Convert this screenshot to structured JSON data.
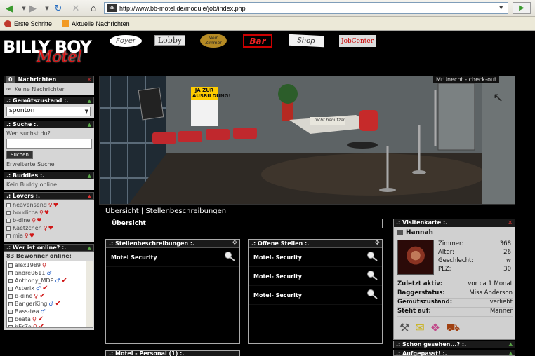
{
  "browser": {
    "url": "http://www.bb-motel.de/module/job/index.php",
    "bookmarks": [
      "Erste Schritte",
      "Aktuelle Nachrichten"
    ]
  },
  "logo": {
    "line1": "BILLY BOY",
    "line2": "Motel"
  },
  "nav": {
    "foyer": "Foyer",
    "lobby": "Lobby",
    "zimmer": "Mein Zimmer",
    "bar": "Bar",
    "shop": "Shop",
    "job": "JobCenter"
  },
  "scene": {
    "checkout": "MrUnecht - check-out",
    "poster": "JA ZUR AUSBILDUNG!",
    "desk_sign": "nicht benutzen"
  },
  "sidebar": {
    "nachrichten": {
      "count": "0",
      "title": "Nachrichten",
      "empty": "Keine Nachrichten"
    },
    "gemuet": {
      "title": ".: Gemütszustand :.",
      "value": "sponton"
    },
    "suche": {
      "title": ".: Suche :.",
      "question": "Wen suchst du?",
      "button": "Suchen",
      "extended": "Erweiterte Suche"
    },
    "buddies": {
      "title": ".: Buddies :.",
      "empty": "Kein Buddy online"
    },
    "lovers": {
      "title": ".: Lovers :.",
      "items": [
        "heavensend",
        "boudicca",
        "b-dine",
        "Kaetzchen",
        "mia"
      ]
    },
    "online": {
      "title": ".: Wer ist online? :.",
      "count_label": "83 Bewohner online:",
      "items": [
        "alex1989",
        "andre0611",
        "Anthony_MDP",
        "Asterix",
        "b-dine",
        "BangerKing",
        "Bass-tea",
        "beata",
        "bErZe"
      ]
    }
  },
  "content": {
    "tab_overview": "Übersicht",
    "tab_sep": "|",
    "tab_desc": "Stellenbeschreibungen",
    "bar_title": "Übersicht",
    "panel1_title": ".: Stellenbeschreibungen :.",
    "panel1_items": [
      "Motel Security"
    ],
    "panel2_title": ".: Offene Stellen :.",
    "panel2_items": [
      "Motel- Security",
      "Motel- Security",
      "Motel- Security"
    ],
    "panel3_title": ".: Motel - Personal (1) :."
  },
  "card": {
    "title": ".: Visitenkarte :.",
    "name": "Hannah",
    "stats": [
      {
        "label": "Zimmer:",
        "value": "368"
      },
      {
        "label": "Alter:",
        "value": "26"
      },
      {
        "label": "Geschlecht:",
        "value": "w"
      },
      {
        "label": "PLZ:",
        "value": "30"
      }
    ],
    "info": [
      {
        "label": "Zuletzt aktiv:",
        "value": "vor ca 1 Monat"
      },
      {
        "label": "Baggerstatus:",
        "value": "Miss Anderson"
      },
      {
        "label": "Gemütszustand:",
        "value": "verliebt"
      },
      {
        "label": "Steht auf:",
        "value": "Männer"
      }
    ]
  },
  "bottom_bars": {
    "gesehen": ".: Schon gesehen...? :.",
    "aufgepasst": ".: Aufgepasst! :."
  },
  "colors": {
    "accent_red": "#d01616",
    "toggle_green": "#5aa847",
    "panel_bg": "#000000",
    "sidebar_bg": "#d6d6d6"
  }
}
